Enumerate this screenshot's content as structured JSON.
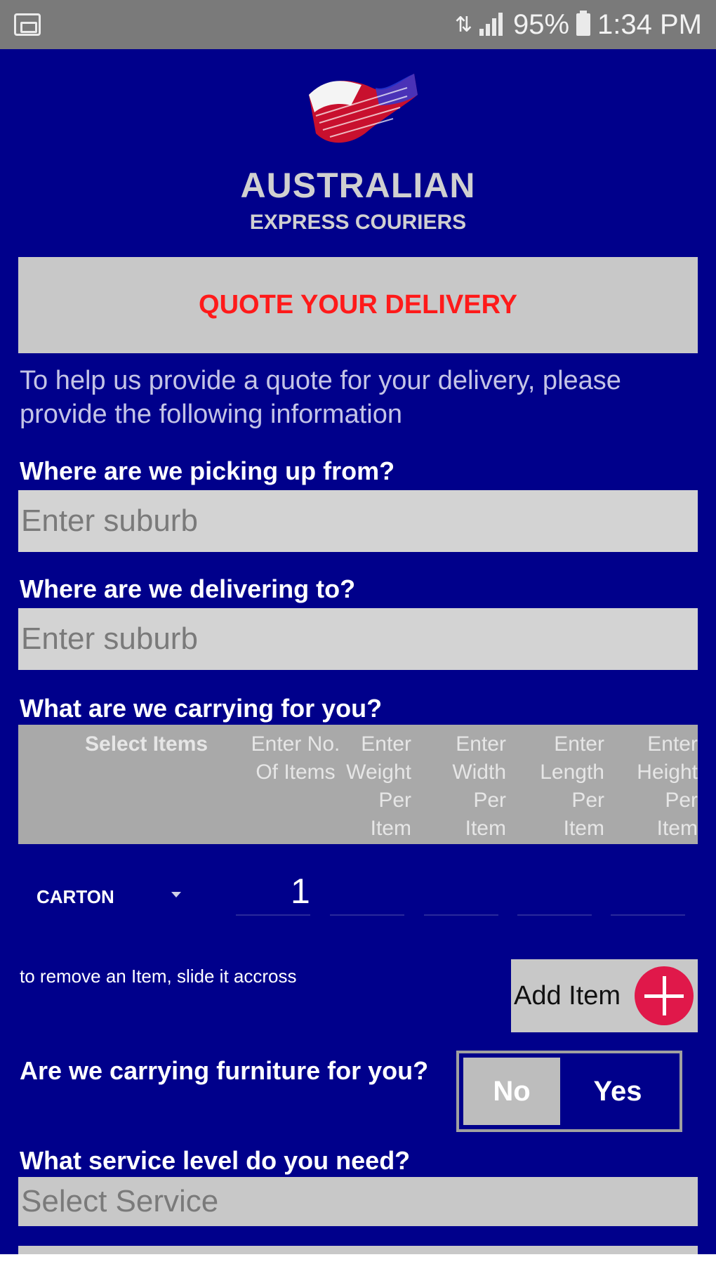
{
  "status_bar": {
    "battery": "95%",
    "time": "1:34 PM"
  },
  "brand": {
    "name": "AUSTRALIAN",
    "subtitle": "EXPRESS COURIERS"
  },
  "quote": {
    "title": "QUOTE YOUR DELIVERY",
    "intro": "To help us provide a quote for your delivery, please provide the following information"
  },
  "pickup": {
    "label": "Where are we picking up from?",
    "placeholder": "Enter suburb"
  },
  "delivery": {
    "label": "Where are we delivering to?",
    "placeholder": "Enter suburb"
  },
  "items": {
    "label": "What are we carrying for you?",
    "headers": [
      "Select Items",
      "Enter No. Of Items",
      "Enter Weight Per Item",
      "Enter Width Per Item",
      "Enter Length Per Item",
      "Enter Height Per Item"
    ],
    "rows": [
      {
        "type": "CARTON",
        "quantity": "1"
      }
    ],
    "remove_hint": "to remove an Item, slide it accross",
    "add_label": "Add Item"
  },
  "furniture": {
    "label": "Are we carrying furniture for you?",
    "no_label": "No",
    "yes_label": "Yes",
    "selected": "No"
  },
  "service": {
    "label": "What service level do you need?",
    "placeholder": "Select Service"
  },
  "colors": {
    "background": "#00008b",
    "accent_red": "#ff1a1a",
    "add_button": "#e0184a"
  }
}
